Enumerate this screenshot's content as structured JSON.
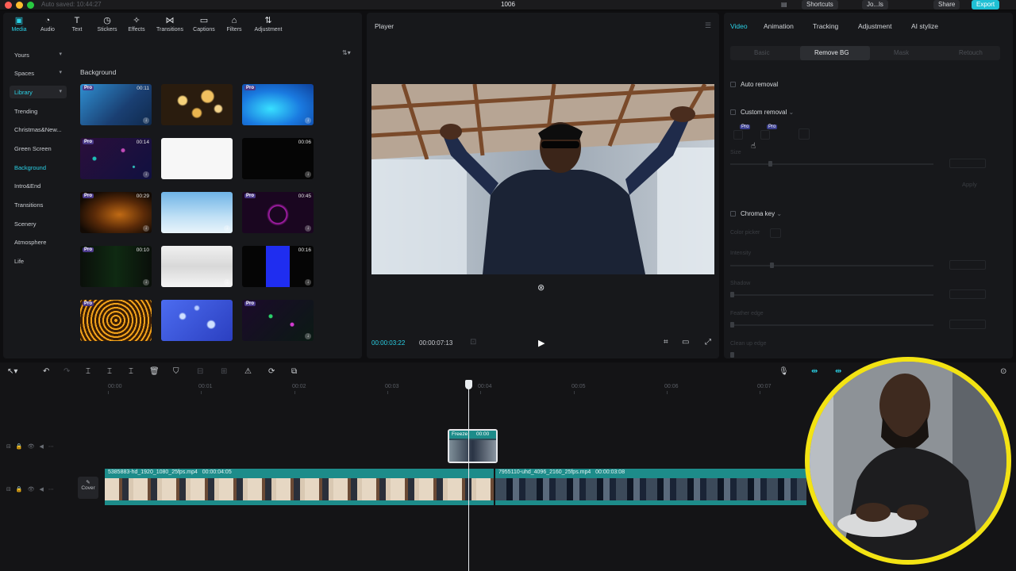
{
  "titlebar": {
    "autosave": "Auto saved: 10:44:27",
    "title": "1006",
    "shortcuts": "Shortcuts",
    "user": "Jo...ls",
    "share": "Share",
    "export": "Export"
  },
  "toolbar": [
    {
      "label": "Media",
      "icon": "media-icon"
    },
    {
      "label": "Audio",
      "icon": "audio-icon"
    },
    {
      "label": "Text",
      "icon": "text-icon"
    },
    {
      "label": "Stickers",
      "icon": "stickers-icon"
    },
    {
      "label": "Effects",
      "icon": "effects-icon"
    },
    {
      "label": "Transitions",
      "icon": "transitions-icon"
    },
    {
      "label": "Captions",
      "icon": "captions-icon"
    },
    {
      "label": "Filters",
      "icon": "filters-icon"
    },
    {
      "label": "Adjustment",
      "icon": "adjustment-icon"
    }
  ],
  "sidebar": [
    {
      "label": "Yours"
    },
    {
      "label": "Spaces"
    },
    {
      "label": "Library"
    },
    {
      "label": "Trending"
    },
    {
      "label": "Christmas&New..."
    },
    {
      "label": "Green Screen"
    },
    {
      "label": "Background"
    },
    {
      "label": "Intro&End"
    },
    {
      "label": "Transitions"
    },
    {
      "label": "Scenery"
    },
    {
      "label": "Atmosphere"
    },
    {
      "label": "Life"
    }
  ],
  "library": {
    "section_title": "Background",
    "thumbs": [
      {
        "pro": "Pro",
        "duration": "00:11"
      },
      {
        "pro": "",
        "duration": ""
      },
      {
        "pro": "Pro",
        "duration": ""
      },
      {
        "pro": "Pro",
        "duration": "00:14"
      },
      {
        "pro": "",
        "duration": ""
      },
      {
        "pro": "",
        "duration": "00:06"
      },
      {
        "pro": "Pro",
        "duration": "00:29"
      },
      {
        "pro": "",
        "duration": ""
      },
      {
        "pro": "Pro",
        "duration": "00:45"
      },
      {
        "pro": "Pro",
        "duration": "00:10"
      },
      {
        "pro": "",
        "duration": ""
      },
      {
        "pro": "",
        "duration": "00:16"
      },
      {
        "pro": "Pro",
        "duration": ""
      },
      {
        "pro": "",
        "duration": ""
      },
      {
        "pro": "Pro",
        "duration": ""
      }
    ]
  },
  "player": {
    "title": "Player",
    "current_time": "00:00:03:22",
    "total_time": "00:00:07:13"
  },
  "inspector": {
    "tabs": [
      "Video",
      "Animation",
      "Tracking",
      "Adjustment",
      "AI stylize"
    ],
    "segments": [
      "Basic",
      "Remove BG",
      "Mask",
      "Retouch"
    ],
    "auto_removal": "Auto removal",
    "custom_removal": "Custom removal",
    "pro_badge": "Pro",
    "size_label": "Size",
    "apply": "Apply",
    "chroma_key": "Chroma key",
    "color_picker": "Color picker",
    "intensity": "Intensity",
    "shadow": "Shadow",
    "feather_edge": "Feather edge",
    "clean_up_edge": "Clean up edge"
  },
  "timeline": {
    "ruler": [
      "00:00",
      "00:01",
      "00:02",
      "00:03",
      "00:04",
      "00:05",
      "00:06",
      "00:07"
    ],
    "freeze_label": "Freeze",
    "freeze_time": "00:00",
    "cover": "Cover",
    "clip1_name": "5385883-hd_1920_1080_25fps.mp4",
    "clip1_time": "00:00:04:05",
    "clip2_name": "7955110-uhd_4096_2160_25fps.mp4",
    "clip2_time": "00:00:03:08"
  },
  "colors": {
    "accent": "#2ad1e6",
    "clip": "#1d8c8a",
    "webcam_ring": "#f3e313"
  }
}
